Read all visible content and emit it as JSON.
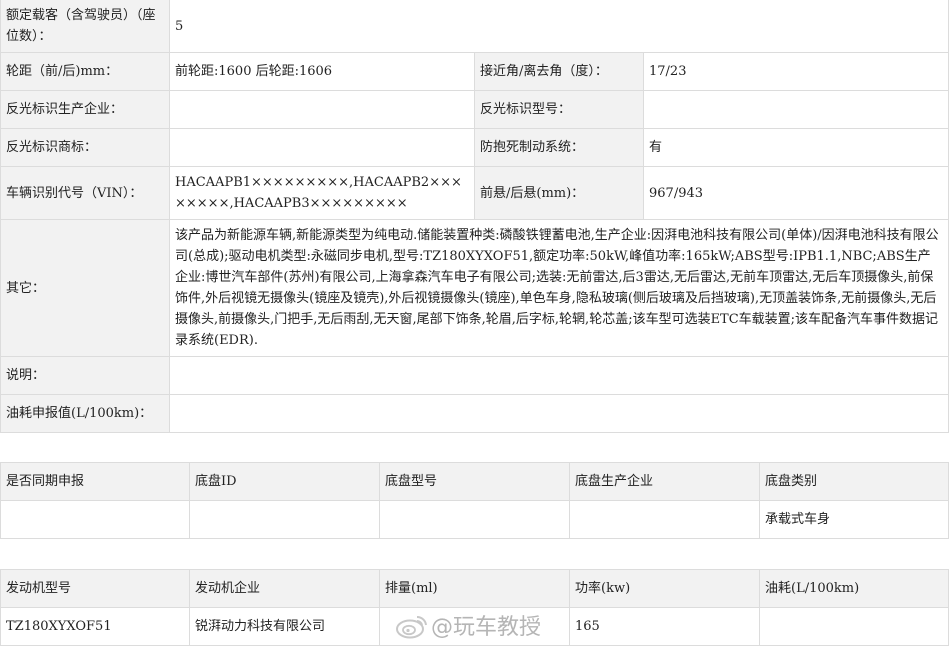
{
  "spec": {
    "seats_label": "额定载客（含驾驶员）（座位数）：",
    "seats_value": "5",
    "wheelbase_label": "轮距（前/后)mm：",
    "wheelbase_value": "前轮距:1600 后轮距:1606",
    "approach_label": "接近角/离去角（度）：",
    "approach_value": "17/23",
    "reflector_maker_label": "反光标识生产企业：",
    "reflector_maker_value": "",
    "reflector_model_label": "反光标识型号：",
    "reflector_model_value": "",
    "reflector_brand_label": "反光标识商标：",
    "reflector_brand_value": "",
    "abs_label": "防抱死制动系统：",
    "abs_value": "有",
    "vin_label": "车辆识别代号（VIN）：",
    "vin_value": "HACAAPB1×××××××××,HACAAPB2××××××××,HACAAPB3×××××××××",
    "overhang_label": "前悬/后悬(mm)：",
    "overhang_value": "967/943",
    "other_label": "其它：",
    "other_value": "该产品为新能源车辆,新能源类型为纯电动.储能装置种类:磷酸铁锂蓄电池,生产企业:因湃电池科技有限公司(单体)/因湃电池科技有限公司(总成);驱动电机类型:永磁同步电机,型号:TZ180XYXOF51,额定功率:50kW,峰值功率:165kW;ABS型号:IPB1.1,NBC;ABS生产企业:博世汽车部件(苏州)有限公司,上海拿森汽车电子有限公司;选装:无前雷达,后3雷达,无后雷达,无前车顶雷达,无后车顶摄像头,前保饰件,外后视镜无摄像头(镜座及镜壳),外后视镜摄像头(镜座),单色车身,隐私玻璃(侧后玻璃及后挡玻璃),无顶盖装饰条,无前摄像头,无后摄像头,前摄像头,门把手,无后雨刮,无天窗,尾部下饰条,轮眉,后字标,轮辋,轮芯盖;该车型可选装ETC车载装置;该车配备汽车事件数据记录系统(EDR).",
    "note_label": "说明：",
    "note_value": "",
    "fuel_label": "油耗申报值(L/100km)：",
    "fuel_value": ""
  },
  "chassis": {
    "headers": [
      "是否同期申报",
      "底盘ID",
      "底盘型号",
      "底盘生产企业",
      "底盘类别"
    ],
    "row": [
      "",
      "",
      "",
      "",
      "承载式车身"
    ]
  },
  "engine": {
    "headers": [
      "发动机型号",
      "发动机企业",
      "排量(ml)",
      "功率(kw)",
      "油耗(L/100km)"
    ],
    "row": [
      "TZ180XYXOF51",
      "锐湃动力科技有限公司",
      "",
      "165",
      ""
    ]
  },
  "watermark": "@玩车教授"
}
